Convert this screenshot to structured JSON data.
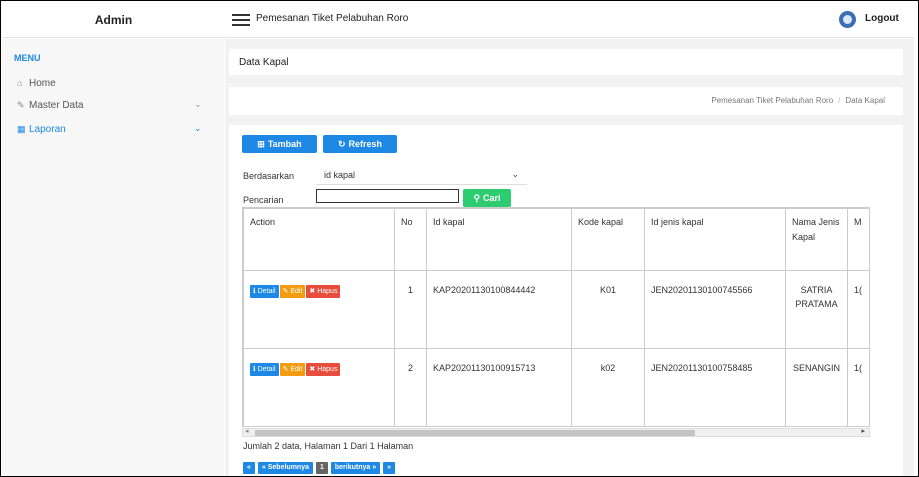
{
  "header": {
    "brand": "Admin",
    "app_title": "Pemesanan Tiket Pelabuhan Roro",
    "logout_label": "Logout"
  },
  "sidebar": {
    "menu_label": "MENU",
    "items": [
      {
        "label": "Home",
        "icon": "home-icon",
        "has_submenu": false
      },
      {
        "label": "Master Data",
        "icon": "edit-icon",
        "has_submenu": true
      },
      {
        "label": "Laporan",
        "icon": "calendar-icon",
        "has_submenu": true,
        "active": true
      }
    ]
  },
  "page": {
    "title": "Data Kapal",
    "breadcrumb": [
      "Pemesanan Tiket Pelabuhan Roro",
      "Data Kapal"
    ]
  },
  "toolbar": {
    "tambah_label": "Tambah",
    "refresh_label": "Refresh"
  },
  "filter": {
    "by_label": "Berdasarkan",
    "selected": "id kapal",
    "search_label": "Pencarian",
    "search_value": "",
    "search_button": "Cari"
  },
  "table": {
    "columns": [
      "Action",
      "No",
      "Id kapal",
      "Kode kapal",
      "Id jenis kapal",
      "Nama Jenis Kapal",
      "M"
    ],
    "action_labels": {
      "detail": "Detail",
      "edit": "Edit",
      "hapus": "Hapus"
    },
    "rows": [
      {
        "no": "1",
        "id_kapal": "KAP20201130100844442",
        "kode_kapal": "K01",
        "id_jenis_kapal": "JEN20201130100745566",
        "nama_jenis_kapal": "SATRIA PRATAMA",
        "m": "1("
      },
      {
        "no": "2",
        "id_kapal": "KAP20201130100915713",
        "kode_kapal": "k02",
        "id_jenis_kapal": "JEN20201130100758485",
        "nama_jenis_kapal": "SENANGIN",
        "m": "1("
      }
    ]
  },
  "summary": "Jumlah 2 data, Halaman 1 Dari 1 Halaman",
  "pager": {
    "first": "«",
    "prev": "« Sebelumnya",
    "current": "1",
    "next": "berikutnya »",
    "last": "»"
  },
  "colors": {
    "primary": "#1e88e5",
    "success": "#2ecc71",
    "warning": "#f39c12",
    "danger": "#e74c3c"
  }
}
